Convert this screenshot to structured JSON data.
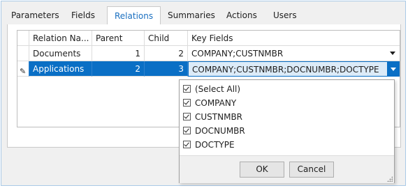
{
  "tabs": [
    {
      "label": "Parameters",
      "active": false
    },
    {
      "label": "Fields",
      "active": false
    },
    {
      "label": "Relations",
      "active": true
    },
    {
      "label": "Summaries",
      "active": false
    },
    {
      "label": "Actions",
      "active": false
    },
    {
      "label": "Users",
      "active": false
    }
  ],
  "grid": {
    "columns": [
      "Relation Na...",
      "Parent",
      "Child",
      "Key Fields"
    ],
    "rows": [
      {
        "relation": "Documents",
        "parent": "1",
        "child": "2",
        "key_fields": "COMPANY;CUSTNMBR",
        "selected": false
      },
      {
        "relation": "Applications",
        "parent": "2",
        "child": "3",
        "key_fields": "COMPANY;CUSTNMBR;DOCNUMBR;DOCTYPE",
        "selected": true
      }
    ],
    "edit_indicator": "pencil-icon"
  },
  "dropdown": {
    "options": [
      {
        "label": "(Select All)",
        "checked": true
      },
      {
        "label": "COMPANY",
        "checked": true
      },
      {
        "label": "CUSTNMBR",
        "checked": true
      },
      {
        "label": "DOCNUMBR",
        "checked": true
      },
      {
        "label": "DOCTYPE",
        "checked": true
      }
    ],
    "ok_label": "OK",
    "cancel_label": "Cancel"
  },
  "colors": {
    "accent": "#0a6fc5",
    "active_tab_text": "#1a6fc0",
    "window_border": "#a9c9e6"
  }
}
